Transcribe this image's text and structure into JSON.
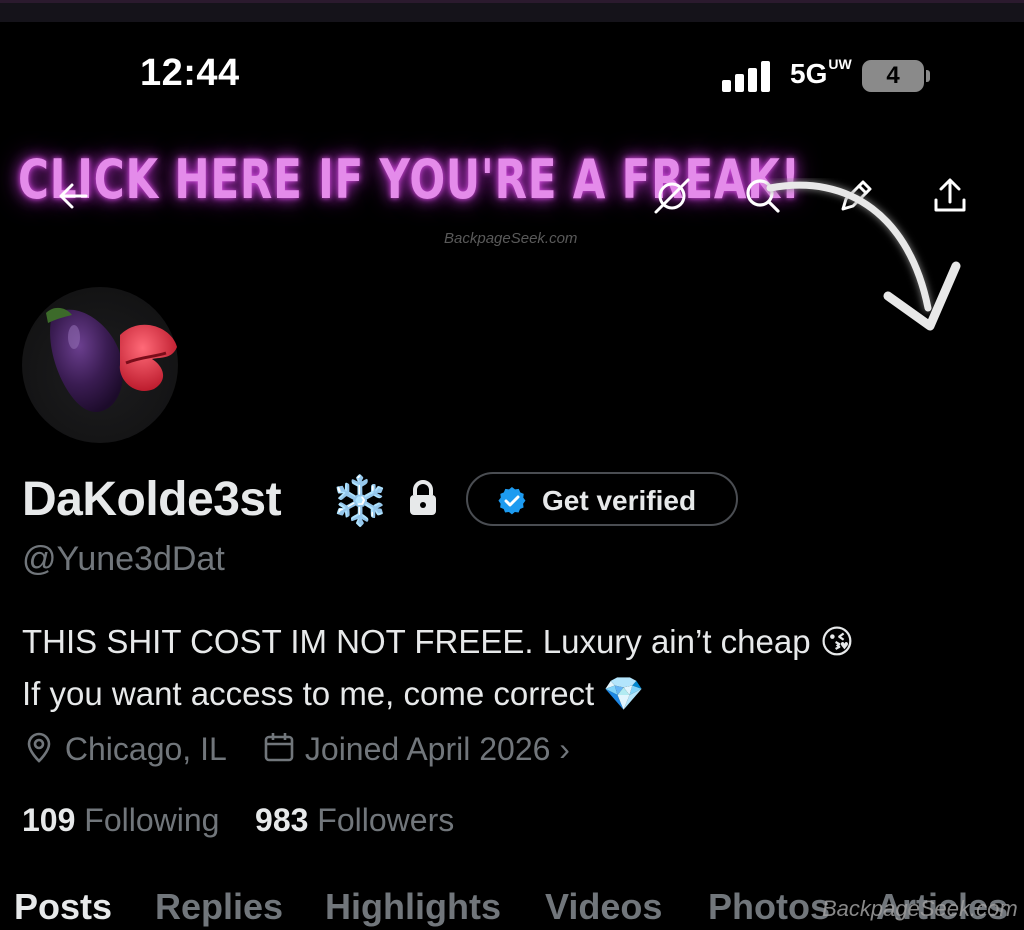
{
  "status_bar": {
    "time": "12:44",
    "network": "5G",
    "network_suffix": "UW",
    "battery": "4"
  },
  "banner": {
    "text": "CLICK HERE IF YOU'RE A FREAK!",
    "watermark": "BackpageSeek.com"
  },
  "header_icons": [
    "back-arrow-icon",
    "grok-icon",
    "search-icon",
    "edit-icon",
    "share-icon"
  ],
  "profile": {
    "display_name": "DaKolde3st",
    "name_emoji": "❄️",
    "handle": "@Yune3dDat",
    "get_verified_label": "Get verified",
    "bio_line1": "THIS SHIT COST IM NOT FREEE. Luxury ain’t cheap",
    "bio_emoji1": "😘",
    "bio_line2": "If you want access to me, come correct",
    "bio_emoji2": "💎",
    "location": "Chicago, IL",
    "joined": "Joined April 2026",
    "joined_chevron": "›",
    "following_count": "109",
    "following_label": "Following",
    "followers_count": "983",
    "followers_label": "Followers"
  },
  "tabs": [
    {
      "label": "Posts",
      "active": true
    },
    {
      "label": "Replies",
      "active": false
    },
    {
      "label": "Highlights",
      "active": false
    },
    {
      "label": "Videos",
      "active": false
    },
    {
      "label": "Photos",
      "active": false
    },
    {
      "label": "Articles",
      "active": false
    }
  ],
  "watermark_bottom": "BackpageSeek.com",
  "colors": {
    "background": "#000000",
    "primary_text": "#e7e9ea",
    "secondary_text": "#71767b",
    "verified_blue": "#1d9bf0",
    "neon_pink": "#e48bea"
  }
}
